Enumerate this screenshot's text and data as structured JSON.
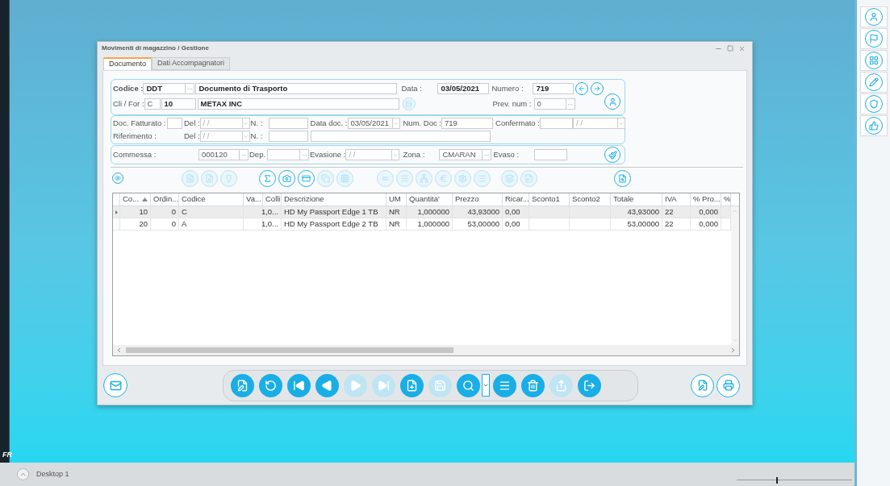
{
  "desktop": {
    "corner_label": "FR",
    "taskbar": {
      "label": "Desktop 1",
      "zoom_slider": {
        "level": 0.34
      }
    }
  },
  "window": {
    "title": "Movimenti di magazzino / Gestione"
  },
  "tabs": [
    {
      "label": "Documento",
      "selected": true
    },
    {
      "label": "Dati Accompagnatori",
      "selected": false
    }
  ],
  "header": {
    "codice_label": "Codice :",
    "codice": "DDT",
    "codice_desc": "Documento di Trasporto",
    "data_label": "Data :",
    "data": "03/05/2021",
    "numero_label": "Numero :",
    "numero": "719",
    "clifor_label": "Cli / For :",
    "clifor_type": "C",
    "clifor_code": "10",
    "clifor_name": "METAX INC",
    "prev_num_label": "Prev. num :",
    "prev_num": "0"
  },
  "references": {
    "doc_fatturato_label": "Doc. Fatturato :",
    "del_label": "Del :",
    "del_date": "/ /",
    "n_label": "N. :",
    "data_doc_label": "Data doc. :",
    "data_doc": "03/05/2021",
    "num_doc_label": "Num. Doc :",
    "num_doc": "719",
    "confermato_label": "Confermato :",
    "confermato_date": "/ /",
    "riferimento_label": "Riferimento :",
    "del2_label": "Del :",
    "del2_date": "/ /",
    "n2_label": "N. :"
  },
  "commessa": {
    "label": "Commessa :",
    "value": "000120",
    "dep_label": "Dep.",
    "evasione_label": "Evasione :",
    "evasione_date": "/ /",
    "zona_label": "Zona :",
    "zona": "CMARAN",
    "evaso_label": "Evaso :"
  },
  "function_toolbar": [
    [
      {
        "disabled": false
      }
    ],
    [
      {
        "disabled": true
      },
      {
        "disabled": true
      },
      {
        "disabled": true
      }
    ],
    [
      {
        "disabled": false
      },
      {
        "disabled": false
      },
      {
        "disabled": false
      },
      {
        "disabled": true
      },
      {
        "disabled": true
      }
    ],
    [
      {
        "disabled": true
      },
      {
        "disabled": true
      },
      {
        "disabled": true
      },
      {
        "disabled": true
      },
      {
        "disabled": true
      },
      {
        "disabled": true
      }
    ],
    [
      {
        "disabled": true
      },
      {
        "disabled": true
      }
    ],
    [
      {
        "disabled": false
      }
    ]
  ],
  "table": {
    "columns": [
      {
        "label": "Co...",
        "sorted": true
      },
      {
        "label": "Ordin...",
        "sorted": false
      },
      {
        "label": "Codice",
        "sorted": false
      },
      {
        "label": "Va...",
        "sorted": false
      },
      {
        "label": "Colli",
        "sorted": false
      },
      {
        "label": "Descrizione",
        "sorted": false
      },
      {
        "label": "UM",
        "sorted": false
      },
      {
        "label": "Quantita'",
        "sorted": false
      },
      {
        "label": "Prezzo",
        "sorted": false
      },
      {
        "label": "Ricar...",
        "sorted": false
      },
      {
        "label": "Sconto1",
        "sorted": false
      },
      {
        "label": "Sconto2",
        "sorted": false
      },
      {
        "label": "Totale",
        "sorted": false
      },
      {
        "label": "IVA",
        "sorted": false
      },
      {
        "label": "% Pro...",
        "sorted": false
      },
      {
        "label": "%",
        "sorted": false
      }
    ],
    "rows": [
      {
        "selected": true,
        "cells": [
          "10",
          "0",
          "C",
          null,
          "1,0...",
          "HD My Passport Edge 1 TB",
          "NR",
          "1,000000",
          "43,93000",
          "0,00",
          null,
          null,
          "43,93000",
          "22",
          "0,000",
          null
        ]
      },
      {
        "selected": false,
        "cells": [
          "20",
          "0",
          "A",
          null,
          "1,0...",
          "HD My Passport Edge 2 TB",
          "NR",
          "1,000000",
          "53,00000",
          "0,00",
          null,
          null,
          "53,00000",
          "22",
          "0,000",
          null
        ]
      }
    ]
  },
  "nav_toolbar": [
    {
      "kind": "button",
      "disabled": false
    },
    {
      "kind": "button",
      "disabled": false
    },
    {
      "kind": "button",
      "disabled": false
    },
    {
      "kind": "button",
      "disabled": false
    },
    {
      "kind": "button",
      "disabled": true
    },
    {
      "kind": "button",
      "disabled": true
    },
    {
      "kind": "button",
      "disabled": false
    },
    {
      "kind": "button",
      "disabled": true
    },
    {
      "kind": "button",
      "disabled": false
    },
    {
      "kind": "dropdown",
      "disabled": false
    },
    {
      "kind": "button",
      "disabled": false
    },
    {
      "kind": "button",
      "disabled": false
    },
    {
      "kind": "button",
      "disabled": true
    },
    {
      "kind": "button",
      "disabled": false
    }
  ]
}
